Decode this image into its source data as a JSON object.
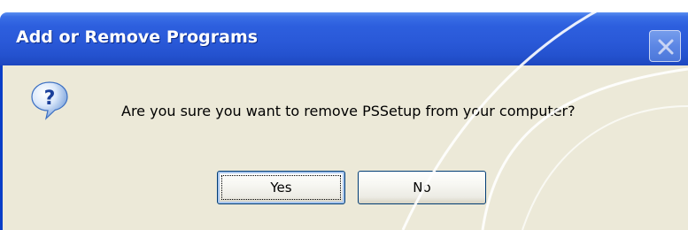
{
  "window": {
    "title": "Add or Remove Programs",
    "close_icon": "close-icon"
  },
  "dialog": {
    "icon": "question-icon",
    "message": "Are you sure you want to remove PSSetup from your computer?"
  },
  "buttons": {
    "yes_label": "Yes",
    "no_label": "No"
  },
  "colors": {
    "titlebar": "#2a59d8",
    "client_background": "#ece9d8",
    "button_border": "#003c74",
    "frame_border": "#0a3ec8"
  }
}
